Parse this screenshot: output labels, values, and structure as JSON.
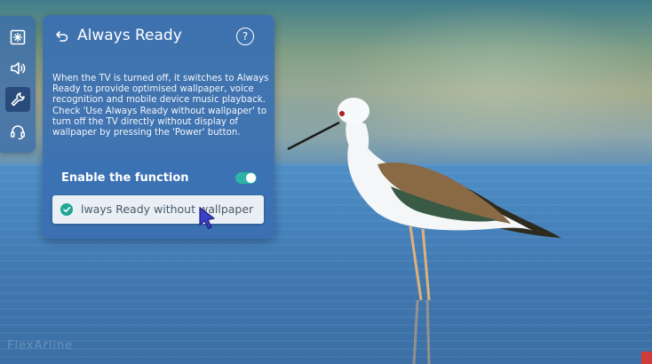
{
  "background": {
    "watermark": "FlexArline",
    "colors": {
      "sky": "#7f9e86",
      "water": "#4682bb"
    }
  },
  "sidebar": {
    "items": [
      {
        "icon": "picture-mode-icon",
        "active": false
      },
      {
        "icon": "sound-icon",
        "active": false
      },
      {
        "icon": "general-wrench-icon",
        "active": true
      },
      {
        "icon": "support-headset-icon",
        "active": false
      }
    ]
  },
  "panel": {
    "title": "Always Ready",
    "help_label": "?",
    "description": "When the TV is turned off, it switches to Always Ready to provide optimised wallpaper, voice recognition and mobile device music playback.\nCheck 'Use Always Ready without wallpaper' to turn off the TV directly without display of wallpaper by pressing the 'Power' button.",
    "enable_label": "Enable the function",
    "enable_on": true,
    "option_label": "lways Ready without wallpaper",
    "option_checked": true,
    "accent_color": "#2fb3a6"
  }
}
